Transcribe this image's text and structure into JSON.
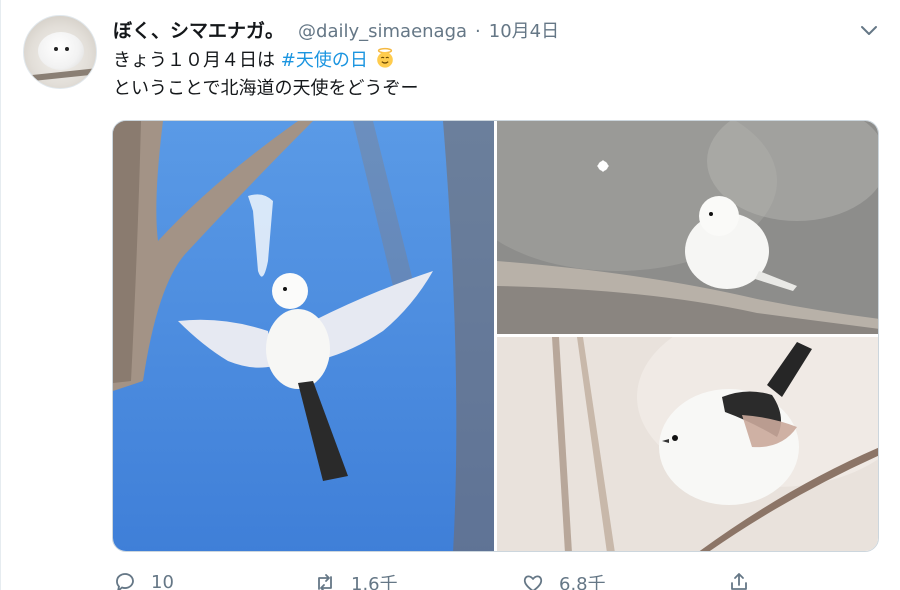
{
  "tweet": {
    "author_name": "ぼく、シマエナガ。",
    "handle": "@daily_simaenaga",
    "separator": "·",
    "date": "10月4日",
    "text_line1_before": "きょう１０月４日は ",
    "hashtag": "#天使の日",
    "text_line2": "ということで北海道の天使をどうぞー",
    "emoji": "angel-face-emoji"
  },
  "actions": {
    "reply_count": "10",
    "retweet_count": "1.6千",
    "like_count": "6.8千"
  },
  "icons": {
    "caret": "chevron-down-icon",
    "reply": "reply-icon",
    "retweet": "retweet-icon",
    "like": "heart-icon",
    "share": "share-icon"
  },
  "colors": {
    "text": "#14171a",
    "secondary": "#657786",
    "link": "#1b95e0",
    "border": "#e6ecf0"
  }
}
